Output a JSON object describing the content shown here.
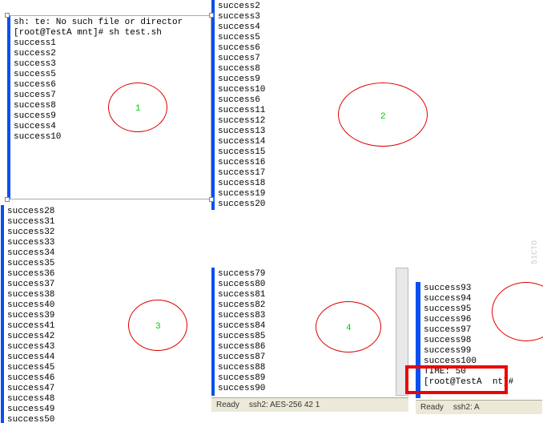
{
  "pane1": {
    "error_line": "sh: te: No such file or director",
    "prompt_line": "[root@TestA mnt]# sh test.sh",
    "lines": [
      "success1",
      "success2",
      "success3",
      "success5",
      "success6",
      "success7",
      "success8",
      "success9",
      "success4",
      "success10"
    ]
  },
  "pane2": {
    "lines": [
      "success2",
      "success3",
      "success4",
      "success5",
      "success6",
      "success7",
      "success8",
      "success9",
      "success10",
      "success6",
      "success11",
      "success12",
      "success13",
      "success14",
      "success15",
      "success16",
      "success17",
      "success18",
      "success19",
      "success20"
    ]
  },
  "pane3": {
    "lines": [
      "success28",
      "success31",
      "success32",
      "success33",
      "success34",
      "success35",
      "success36",
      "success37",
      "success38",
      "success40",
      "success39",
      "success41",
      "success42",
      "success43",
      "success44",
      "success45",
      "success46",
      "success47",
      "success48",
      "success49",
      "success50"
    ]
  },
  "pane4": {
    "lines": [
      "success79",
      "success80",
      "success81",
      "success82",
      "success83",
      "success84",
      "success85",
      "success86",
      "success87",
      "success88",
      "success89",
      "success90"
    ]
  },
  "pane5": {
    "lines": [
      "success93",
      "success94",
      "success95",
      "success96",
      "success97",
      "success98",
      "success99",
      "",
      "success100",
      "TIME: 50"
    ],
    "prompt_tail": "[root@TestA  nt]#"
  },
  "labels": {
    "l1": "1",
    "l2": "2",
    "l3": "3",
    "l4": "4"
  },
  "status4": {
    "cell1": "Ready",
    "cell2": "ssh2: AES-256  42   1"
  },
  "status5": {
    "cell1": "Ready",
    "cell2": "ssh2: A"
  },
  "watermark": "51CTO"
}
